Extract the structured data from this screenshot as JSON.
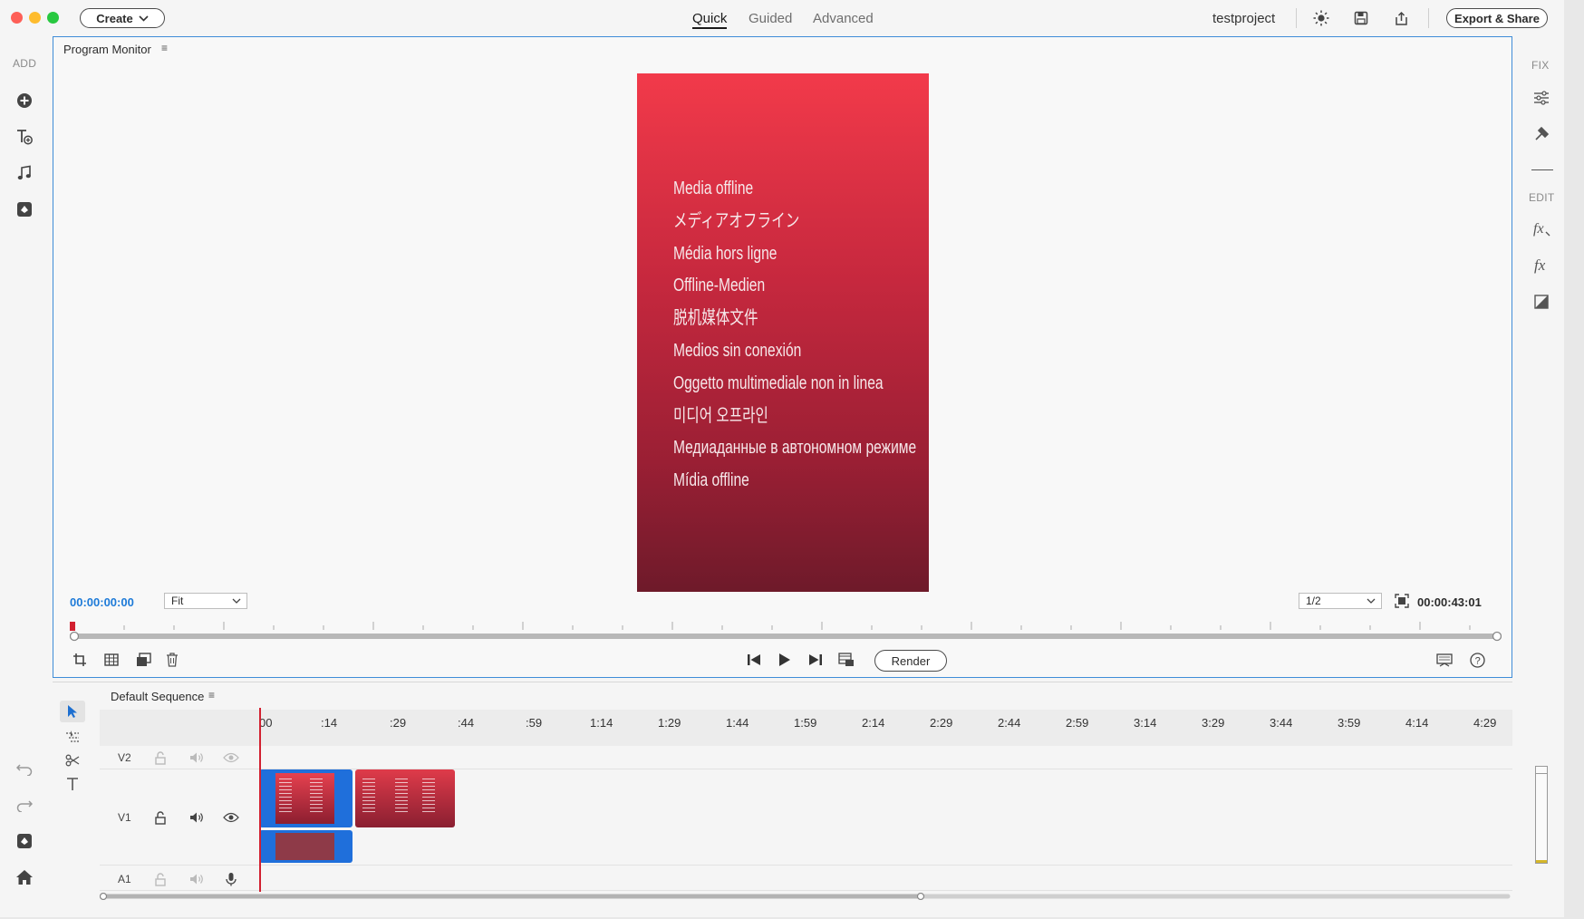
{
  "titlebar": {
    "create_label": "Create",
    "tabs": [
      {
        "label": "Quick",
        "active": true
      },
      {
        "label": "Guided",
        "active": false
      },
      {
        "label": "Advanced",
        "active": false
      }
    ],
    "project_name": "testproject",
    "export_label": "Export & Share"
  },
  "left_rail": {
    "add_label": "ADD"
  },
  "right_rail": {
    "fix_label": "FIX",
    "edit_label": "EDIT"
  },
  "monitor": {
    "title": "Program Monitor",
    "timecode_current": "00:00:00:00",
    "fit_value": "Fit",
    "ratio_value": "1/2",
    "timecode_duration": "00:00:43:01",
    "render_label": "Render",
    "offline_lines": [
      "Media offline",
      "メディアオフライン",
      "Média hors ligne",
      "Offline-Medien",
      "脱机媒体文件",
      "Medios sin conexión",
      "Oggetto multimediale non in linea",
      "미디어 오프라인",
      "Медиаданные в автономном режиме",
      "Mídia offline"
    ]
  },
  "timeline": {
    "title": "Default Sequence",
    "ticks": [
      "00",
      ":14",
      ":29",
      ":44",
      ":59",
      "1:14",
      "1:29",
      "1:44",
      "1:59",
      "2:14",
      "2:29",
      "2:44",
      "2:59",
      "3:14",
      "3:29",
      "3:44",
      "3:59",
      "4:14",
      "4:29"
    ],
    "tracks": [
      {
        "name": "V2"
      },
      {
        "name": "V1"
      },
      {
        "name": "A1"
      }
    ]
  },
  "colors": {
    "accent": "#1d7ad8",
    "selection": "#1f6fdb",
    "clip_red": "#b52b3d",
    "playhead": "#d22030"
  }
}
